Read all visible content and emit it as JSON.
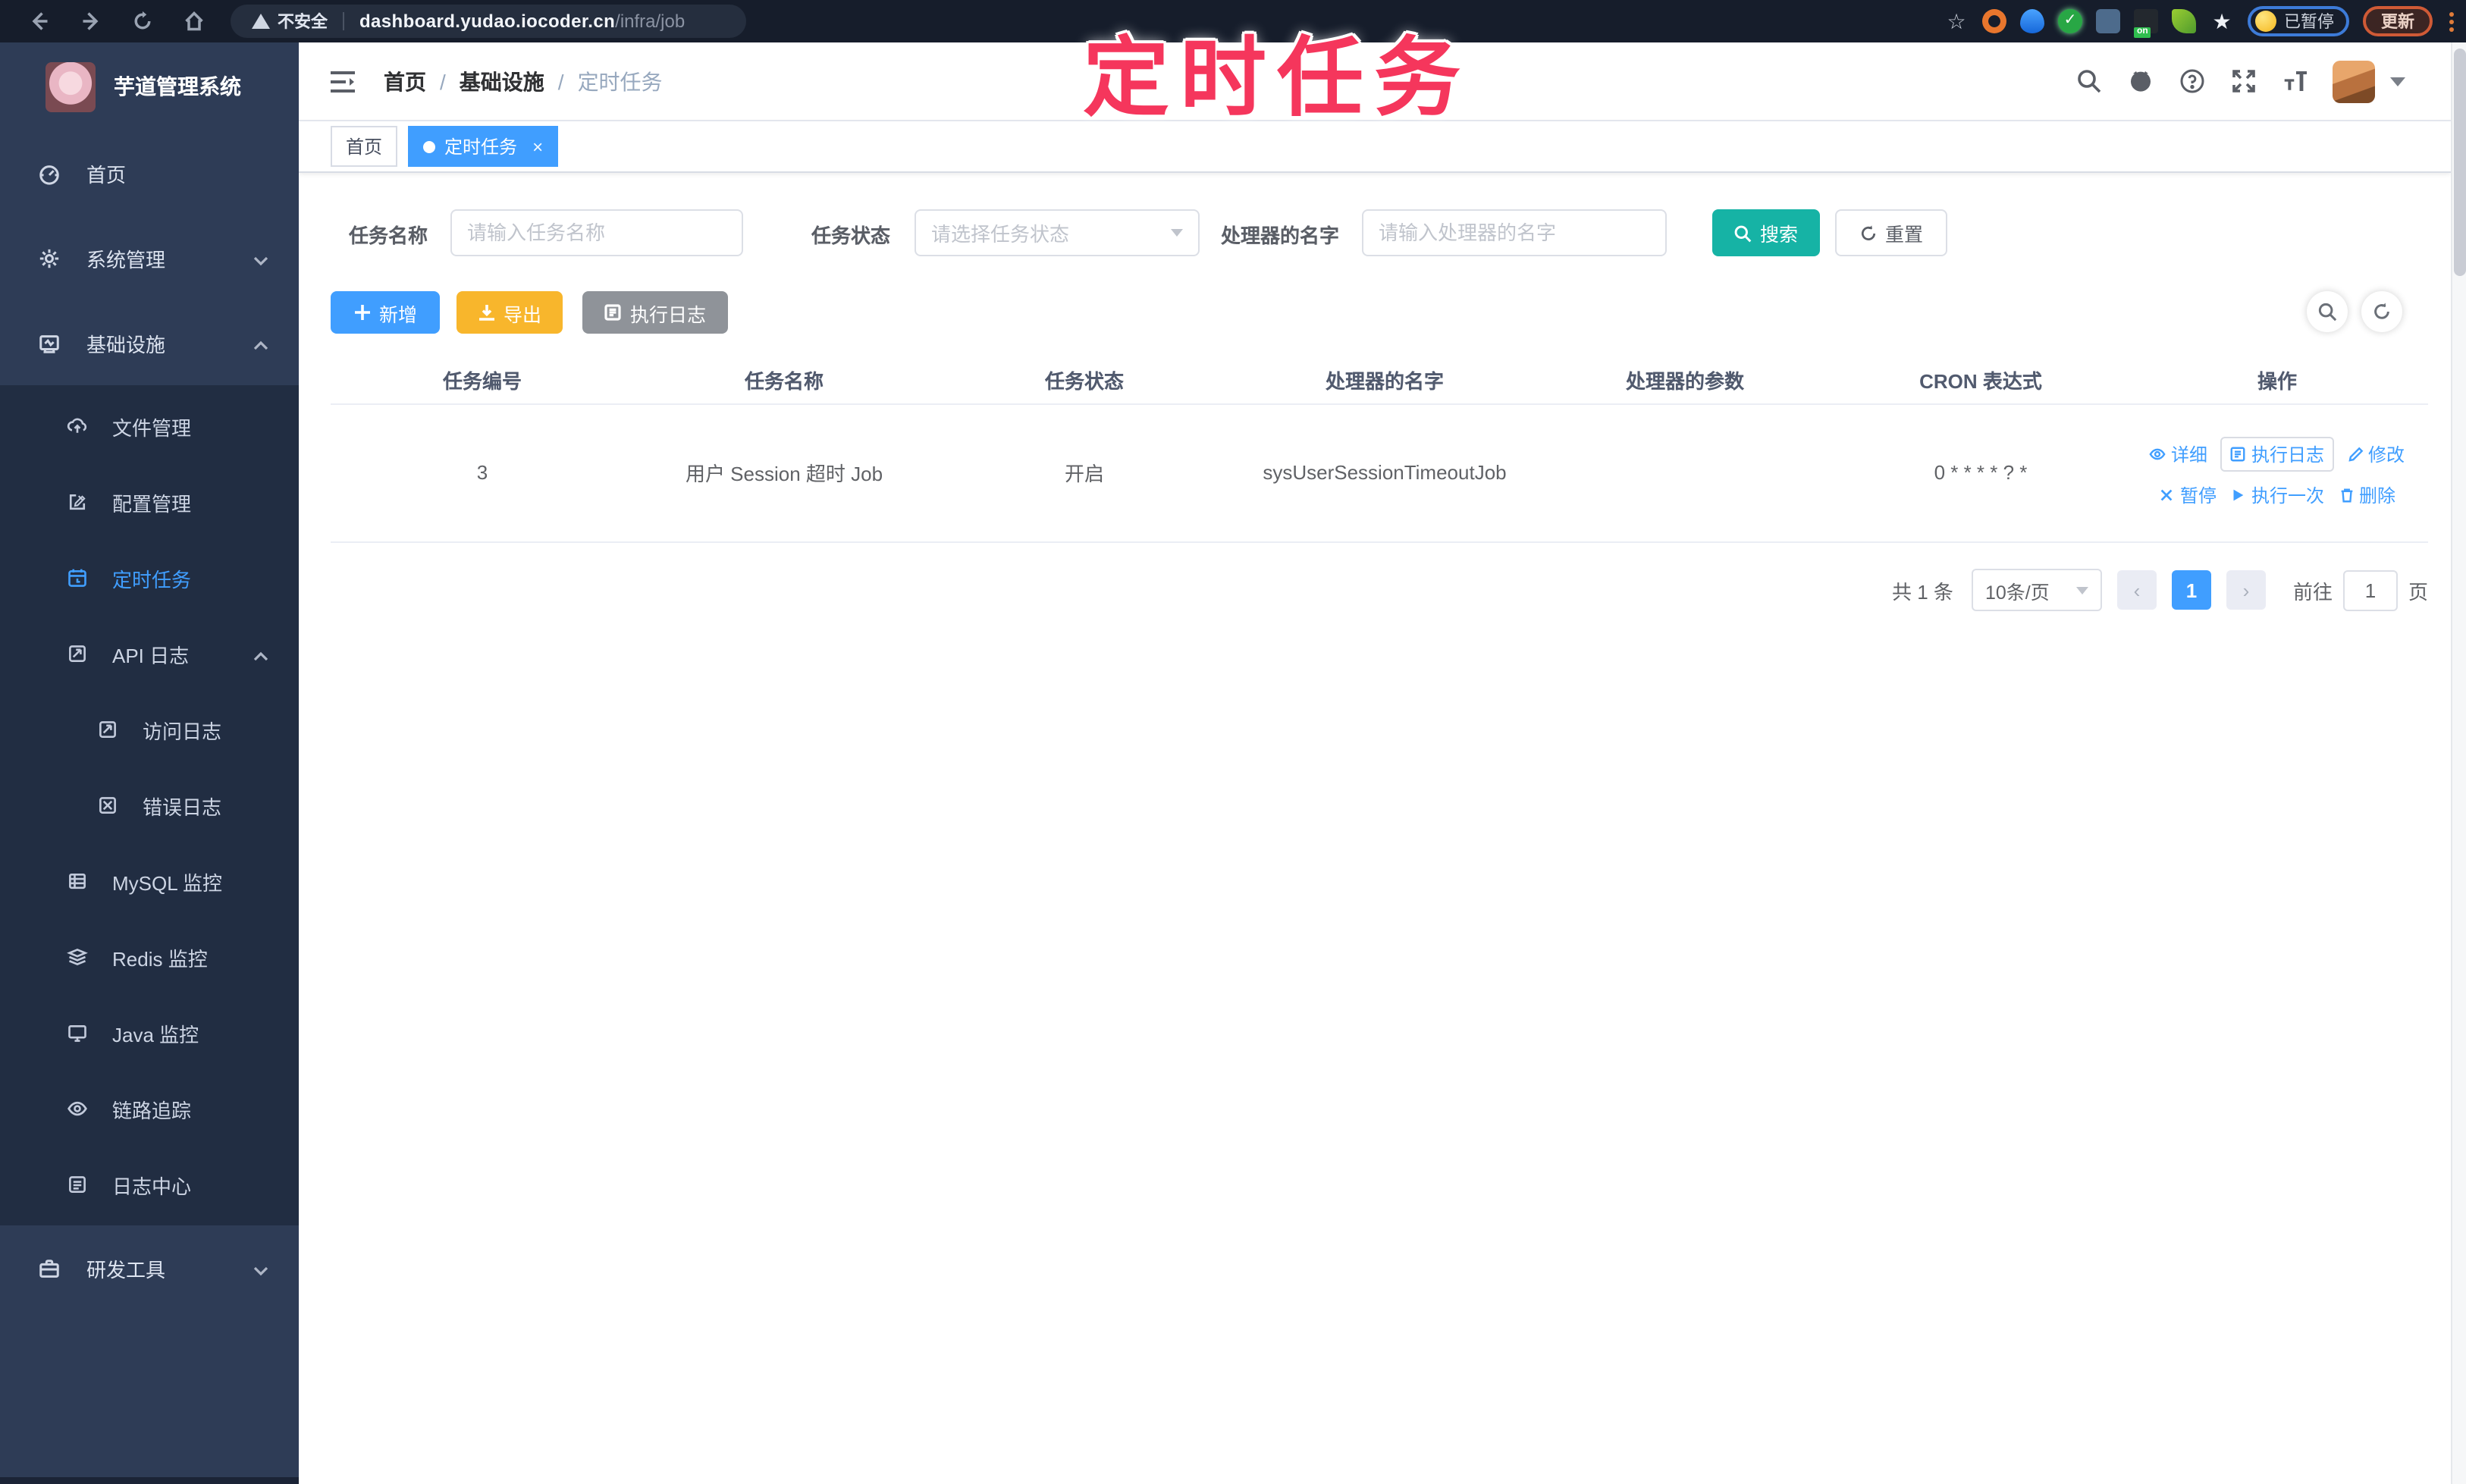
{
  "browser": {
    "security_label": "不安全",
    "url_host": "dashboard.yudao.iocoder.cn",
    "url_path": "/infra/job",
    "extension_on_badge": "on",
    "paused_badge": "已暂停",
    "update_label": "更新"
  },
  "annotation": {
    "text": "定时任务",
    "color": "#f5365c"
  },
  "sidebar": {
    "app_title": "芋道管理系统",
    "top_items": [
      {
        "label": "首页"
      },
      {
        "label": "系统管理"
      },
      {
        "label": "基础设施"
      }
    ],
    "sub_items": [
      {
        "label": "文件管理"
      },
      {
        "label": "配置管理"
      },
      {
        "label": "定时任务",
        "active": true
      },
      {
        "label": "API 日志"
      },
      {
        "label": "访问日志"
      },
      {
        "label": "错误日志"
      },
      {
        "label": "MySQL 监控"
      },
      {
        "label": "Redis 监控"
      },
      {
        "label": "Java 监控"
      },
      {
        "label": "链路追踪"
      },
      {
        "label": "日志中心"
      }
    ],
    "bottom_items": [
      {
        "label": "研发工具"
      }
    ]
  },
  "header": {
    "breadcrumb": [
      {
        "label": "首页"
      },
      {
        "label": "基础设施"
      },
      {
        "label": "定时任务"
      }
    ],
    "separator": "/"
  },
  "tabs": [
    {
      "label": "首页"
    },
    {
      "label": "定时任务",
      "close_glyph": "×"
    }
  ],
  "filters": {
    "name_label": "任务名称",
    "name_placeholder": "请输入任务名称",
    "status_label": "任务状态",
    "status_placeholder": "请选择任务状态",
    "handler_label": "处理器的名字",
    "handler_placeholder": "请输入处理器的名字",
    "search_label": "搜索",
    "reset_label": "重置"
  },
  "toolbar": {
    "add_label": "新增",
    "export_label": "导出",
    "log_label": "执行日志"
  },
  "table": {
    "columns": [
      "任务编号",
      "任务名称",
      "任务状态",
      "处理器的名字",
      "处理器的参数",
      "CRON 表达式",
      "操作"
    ],
    "rows": [
      {
        "id": "3",
        "name": "用户 Session 超时 Job",
        "status": "开启",
        "handler": "sysUserSessionTimeoutJob",
        "param": "",
        "cron": "0 * * * * ? *"
      }
    ],
    "ops_row1": [
      "详细",
      "执行日志",
      "修改"
    ],
    "ops_row2": [
      "暂停",
      "执行一次",
      "删除"
    ]
  },
  "pagination": {
    "total": "共 1 条",
    "page_size": "10条/页",
    "prev_glyph": "‹",
    "next_glyph": "›",
    "current_page": "1",
    "goto_label": "前往",
    "goto_value": "1",
    "unit_label": "页"
  },
  "colors": {
    "primary": "#409eff",
    "search_teal": "#16b3a5",
    "export_orange": "#f8b62c",
    "info_gray": "#8f9399",
    "annotation_pink": "#f5365c",
    "sidebar_bg": "#2e3c56",
    "submenu_bg": "#212d42"
  }
}
